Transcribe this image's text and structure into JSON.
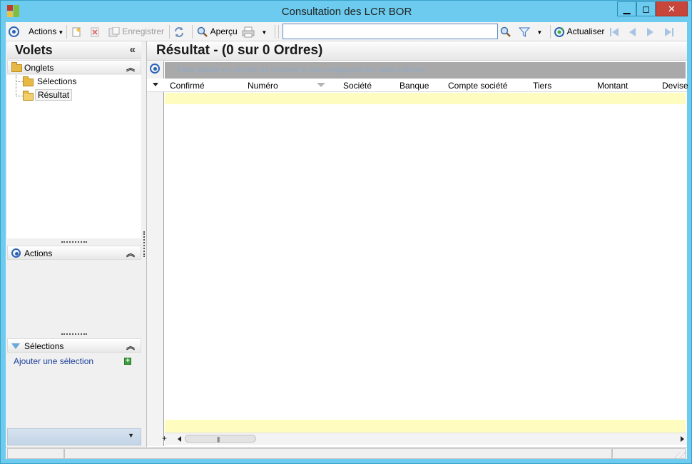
{
  "window": {
    "title": "Consultation des LCR BOR",
    "controls": {
      "minimize": "▁",
      "maximize": "◻",
      "close": "✕"
    }
  },
  "toolbar": {
    "actions_label": "Actions",
    "enregistrer_label": "Enregistrer",
    "apercu_label": "Aperçu",
    "actualiser_label": "Actualiser",
    "search_value": "",
    "icons": [
      "target-icon",
      "new-icon",
      "delete-icon",
      "save-icon",
      "refresh-icon",
      "search-icon",
      "print-icon",
      "search-icon",
      "filter-icon",
      "actualiser-icon",
      "first-icon",
      "prev-icon",
      "next-icon",
      "last-icon"
    ]
  },
  "left_panel": {
    "title": "Volets",
    "collapse_glyph": "«",
    "sections": {
      "onglets": {
        "label": "Onglets",
        "items": [
          "Sélections",
          "Résultat"
        ],
        "selected": "Résultat"
      },
      "actions": {
        "label": "Actions"
      },
      "selections": {
        "label": "Sélections",
        "link": "Ajouter une sélection"
      }
    },
    "section_chevron": "⌃"
  },
  "result_panel": {
    "title": "Résultat - (0 sur 0 Ordres)",
    "group_hint": "Faire glisser un en-tête de colonne ici pour regrouper par cette colonne",
    "columns": [
      "Confirmé",
      "Numéro",
      "Société",
      "Banque",
      "Compte société",
      "Tiers",
      "Montant",
      "Devise"
    ],
    "rows": []
  },
  "colors": {
    "titlebar": "#6ccbee",
    "close_button": "#c7453b",
    "new_row": "#fffcc0",
    "group_band": "#a9a9a9",
    "accent": "#2a63b6"
  }
}
